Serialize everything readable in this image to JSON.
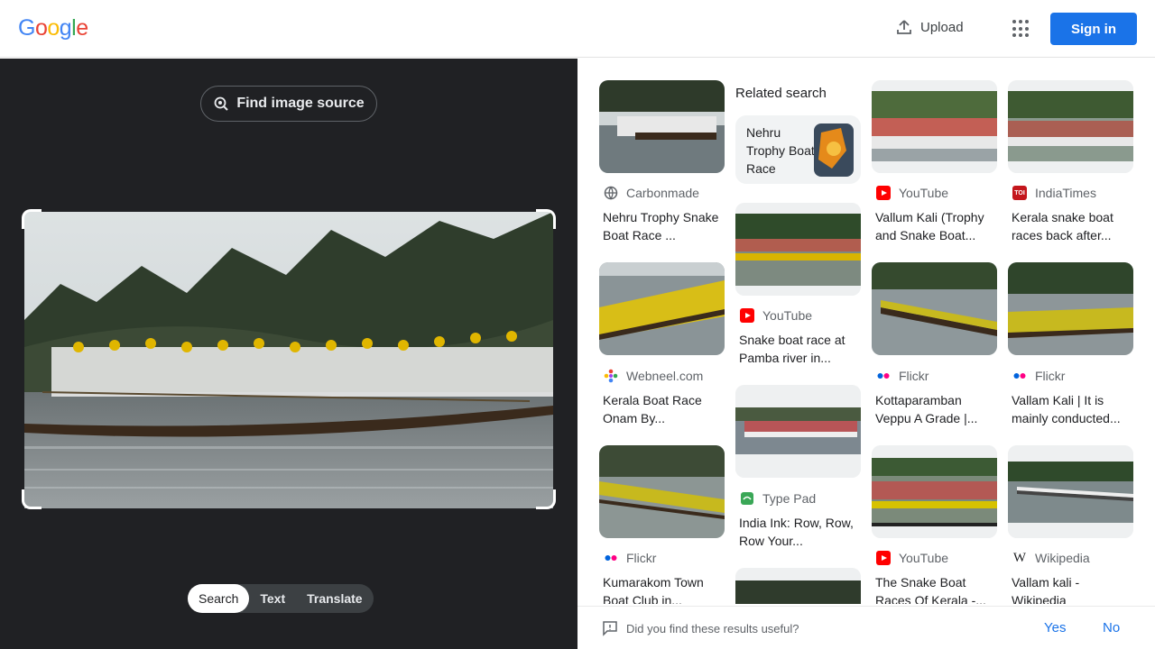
{
  "header": {
    "logo": [
      "G",
      "o",
      "o",
      "g",
      "l",
      "e"
    ],
    "logo_colors": [
      "#4285f4",
      "#ea4335",
      "#fbbc05",
      "#4285f4",
      "#34a853",
      "#ea4335"
    ],
    "upload_label": "Upload",
    "signin_label": "Sign in"
  },
  "left": {
    "find_source_label": "Find image source",
    "tabs": [
      "Search",
      "Text",
      "Translate"
    ],
    "active_tab": "Search"
  },
  "related": {
    "heading": "Related search",
    "chip_label": "Nehru Trophy Boat Race"
  },
  "results": [
    {
      "source": "Carbonmade",
      "icon": "globe-icon",
      "title": "Nehru Trophy Snake Boat Race ..."
    },
    {
      "source": "YouTube",
      "icon": "youtube-icon",
      "title": "Vallum Kali (Trophy and Snake Boat..."
    },
    {
      "source": "IndiaTimes",
      "icon": "indiatimes-icon",
      "title": "Kerala snake boat races back after..."
    },
    {
      "source": "YouTube",
      "icon": "youtube-icon",
      "title": "Snake boat race at Pamba river in..."
    },
    {
      "source": "Webneel.com",
      "icon": "webneel-icon",
      "title": "Kerala Boat Race Onam By..."
    },
    {
      "source": "Flickr",
      "icon": "flickr-icon",
      "title": "Kottaparamban Veppu A Grade |..."
    },
    {
      "source": "Flickr",
      "icon": "flickr-icon",
      "title": "Vallam Kali | It is mainly conducted..."
    },
    {
      "source": "Type Pad",
      "icon": "typepad-icon",
      "title": "India Ink: Row, Row, Row Your..."
    },
    {
      "source": "Flickr",
      "icon": "flickr-icon",
      "title": "Kumarakom Town Boat Club in..."
    },
    {
      "source": "YouTube",
      "icon": "youtube-icon",
      "title": "The Snake Boat Races Of Kerala -..."
    },
    {
      "source": "Wikipedia",
      "icon": "wikipedia-icon",
      "title": "Vallam kali - Wikipedia"
    }
  ],
  "indiatimes_badge": "TOI",
  "wikipedia_badge": "W",
  "feedback": {
    "question": "Did you find these results useful?",
    "yes": "Yes",
    "no": "No"
  },
  "colors": {
    "accent": "#1a73e8",
    "dark_pane": "#202124"
  }
}
